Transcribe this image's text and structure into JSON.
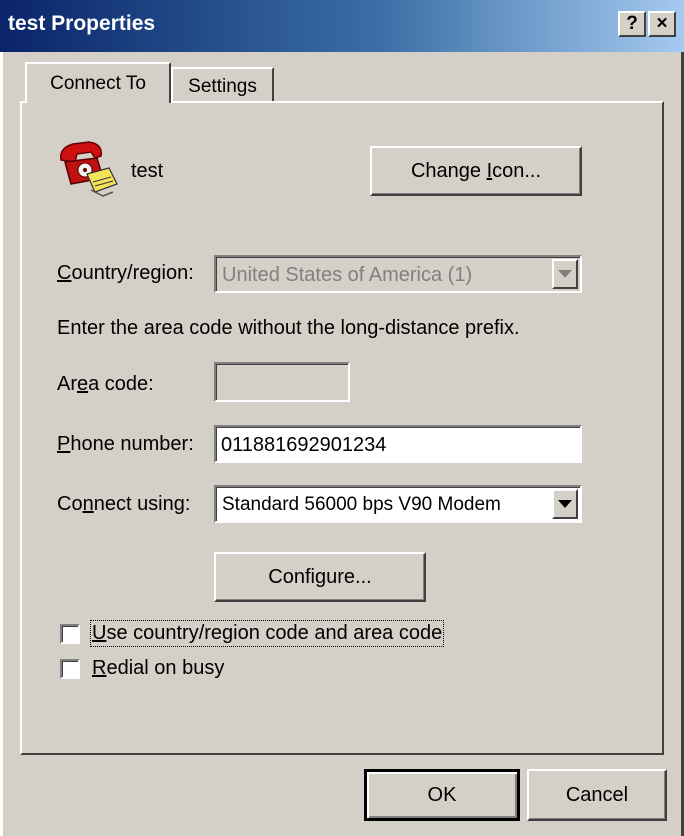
{
  "window": {
    "title": "test Properties",
    "help_glyph": "?",
    "close_glyph": "×"
  },
  "tabs": [
    {
      "label": "Connect To",
      "active": true
    },
    {
      "label": "Settings",
      "active": false
    }
  ],
  "connection": {
    "name": "test",
    "icon": "phone-icon"
  },
  "change_icon_button": {
    "pre": "Change ",
    "key": "I",
    "post": "con..."
  },
  "country": {
    "label_key": "C",
    "label_rest": "ountry/region:",
    "value": "United States of America (1)",
    "enabled": false
  },
  "instruction": "Enter the area code without the long-distance prefix.",
  "area_code": {
    "label_pre": "Ar",
    "label_key": "e",
    "label_post": "a code:",
    "value": ""
  },
  "phone_number": {
    "label_key": "P",
    "label_rest": "hone number:",
    "value": "011881692901234"
  },
  "connect_using": {
    "label_pre": "Co",
    "label_key": "n",
    "label_post": "nect using:",
    "value": "Standard 56000 bps V90 Modem"
  },
  "configure_button": {
    "pre": "Confi",
    "key": "g",
    "post": "ure..."
  },
  "checkboxes": [
    {
      "key": "U",
      "rest": "se country/region code and area code",
      "checked": false
    },
    {
      "key": "R",
      "rest": "edial on busy",
      "checked": false
    }
  ],
  "footer": {
    "ok_label": "OK",
    "cancel_label": "Cancel"
  },
  "colors": {
    "titlebar_start": "#0a246a",
    "titlebar_end": "#a6caf0",
    "face": "#d4d0c8"
  }
}
